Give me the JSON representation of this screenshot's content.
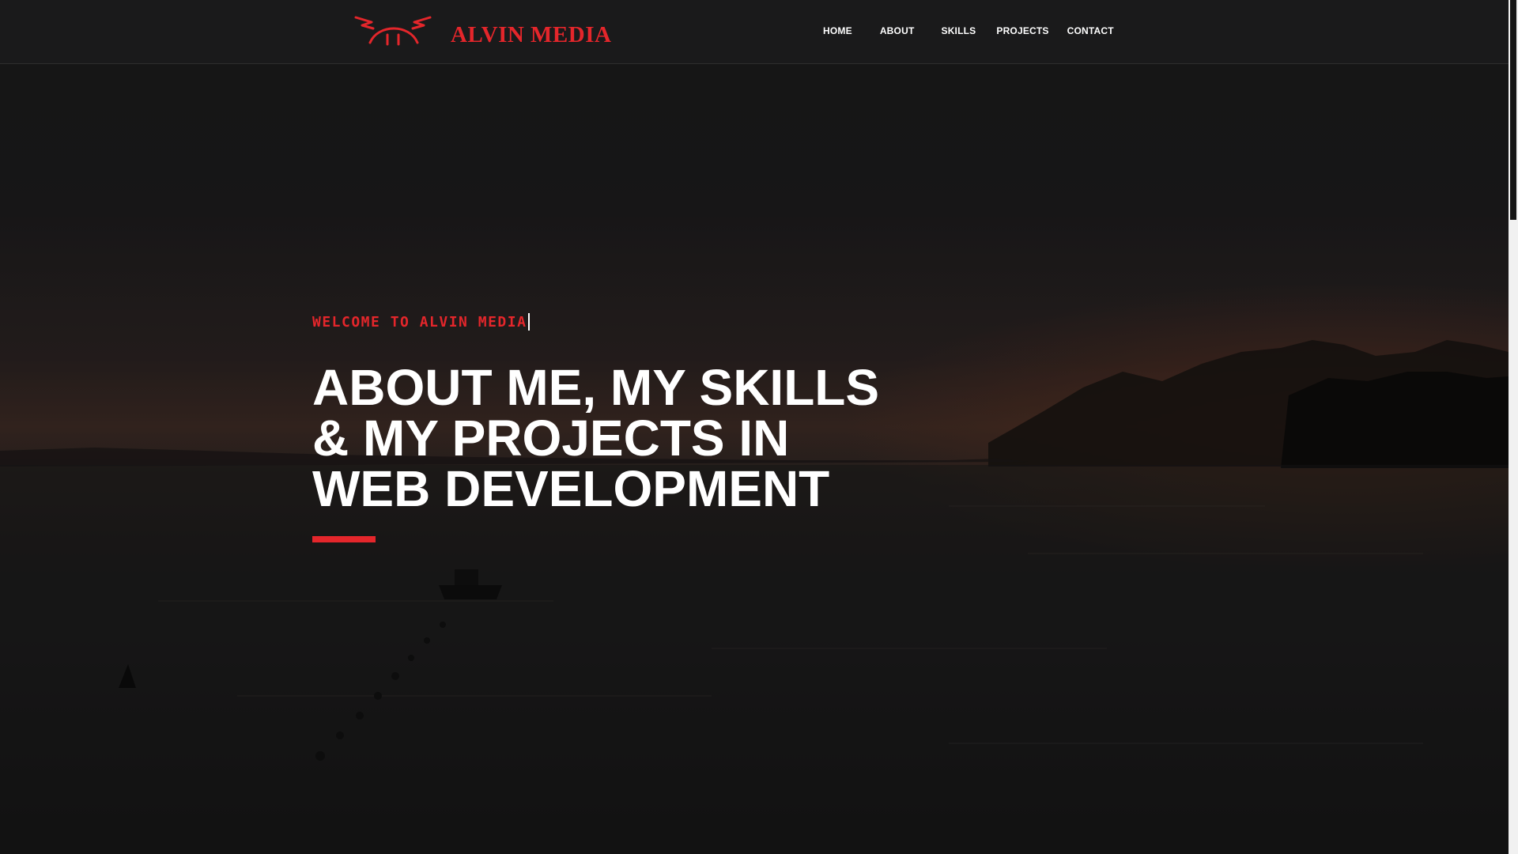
{
  "header": {
    "logo_text": "ALVIN MEDIA",
    "nav": [
      {
        "label": "HOME"
      },
      {
        "label": "ABOUT"
      },
      {
        "label": "SKILLS"
      },
      {
        "label": "PROJECTS"
      },
      {
        "label": "CONTACT"
      }
    ]
  },
  "hero": {
    "kicker": "WELCOME TO ALVIN MEDIA",
    "headline_lines": [
      "ABOUT ME, MY SKILLS",
      "& MY PROJECTS IN",
      "WEB DEVELOPMENT"
    ]
  },
  "colors": {
    "accent": "#e4262b",
    "header_bg": "#1a1a1b",
    "text": "#ffffff"
  },
  "icons": {
    "logo_mark": "antlered-arch-logo-icon"
  }
}
